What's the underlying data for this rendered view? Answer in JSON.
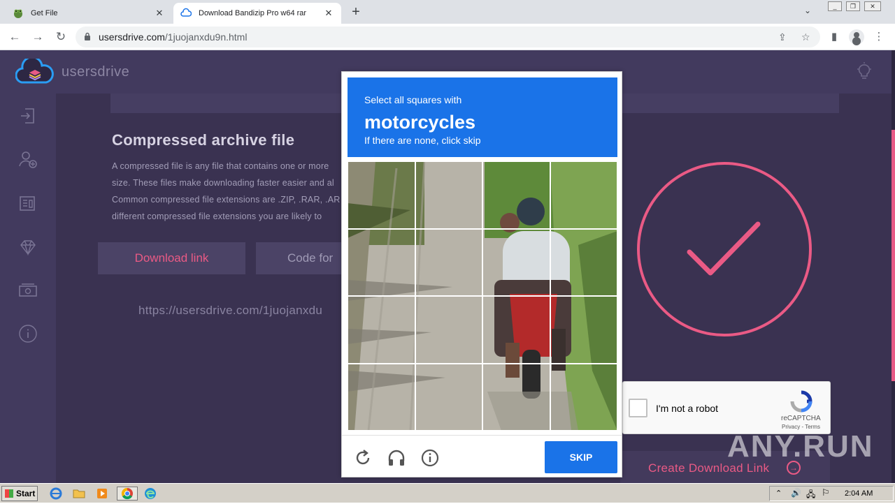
{
  "browser": {
    "tabs": [
      {
        "title": "Get File",
        "active": false
      },
      {
        "title": "Download Bandizip Pro w64 rar",
        "active": true
      }
    ],
    "url_host": "usersdrive.com",
    "url_path": "/1juojanxdu9n.html"
  },
  "site": {
    "brand": "usersdrive",
    "section_title": "Compressed archive file",
    "paragraph_lines": [
      "A compressed file is any file that contains one or more",
      "size. These files make downloading faster easier and al",
      "Common compressed file extensions are .ZIP, .RAR, .AR",
      "different compressed file extensions you are likely to"
    ],
    "download_link_label": "Download link",
    "code_for_label": "Code for",
    "link_text": "https://usersdrive.com/1juojanxdu",
    "create_download_label": "Create Download Link"
  },
  "recaptcha_anchor": {
    "label": "I'm not a robot",
    "brand": "reCAPTCHA",
    "terms": "Privacy - Terms"
  },
  "recaptcha_challenge": {
    "instruction": "Select all squares with",
    "object": "motorcycles",
    "hint": "If there are none, click skip",
    "skip_label": "SKIP",
    "grid_size": 4
  },
  "watermark": "ANY.RUN",
  "taskbar": {
    "start_label": "Start",
    "clock": "2:04 AM"
  },
  "colors": {
    "accent_pink": "#ea5a85",
    "recaptcha_blue": "#1a73e8",
    "page_bg": "#3d3556"
  }
}
